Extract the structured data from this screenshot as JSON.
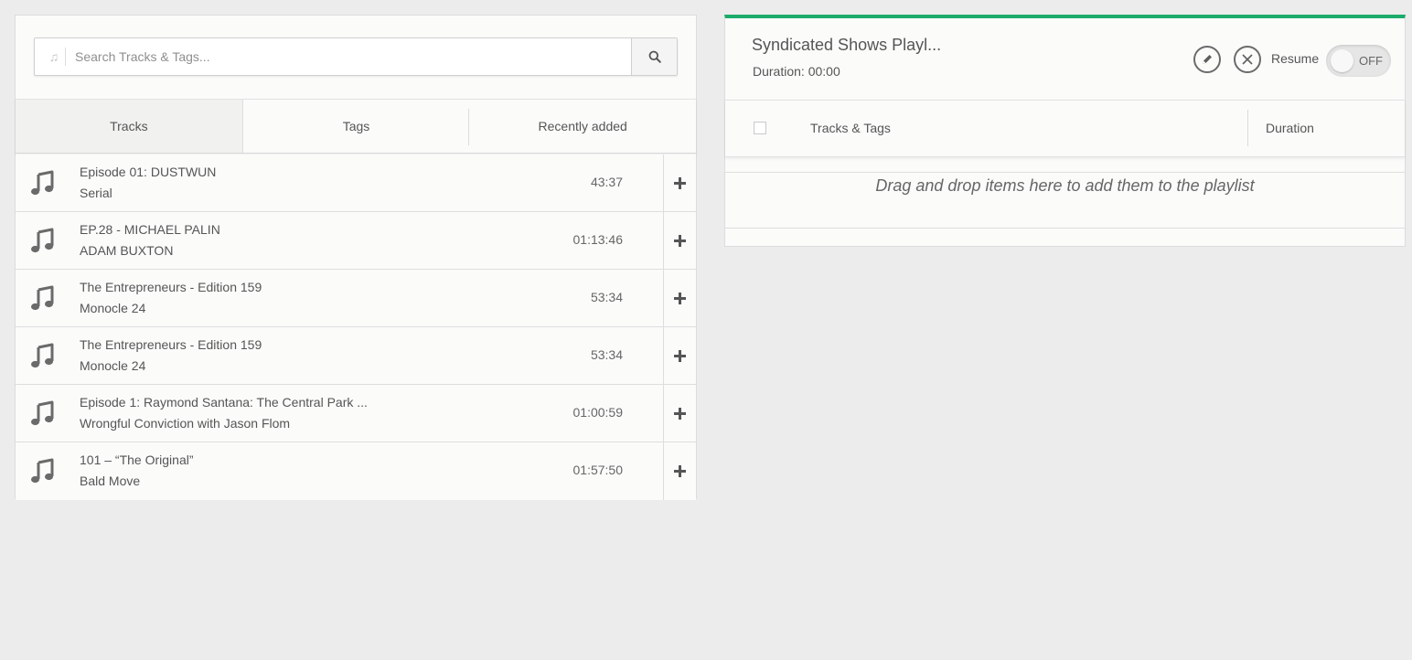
{
  "search": {
    "placeholder": "Search Tracks & Tags..."
  },
  "tabs": [
    {
      "label": "Tracks",
      "active": true
    },
    {
      "label": "Tags",
      "active": false
    },
    {
      "label": "Recently added",
      "active": false
    }
  ],
  "tracks": [
    {
      "title": "Episode 01: DUSTWUN",
      "subtitle": "Serial",
      "duration": "43:37"
    },
    {
      "title": "EP.28 - MICHAEL PALIN",
      "subtitle": "ADAM BUXTON",
      "duration": "01:13:46"
    },
    {
      "title": "The Entrepreneurs - Edition 159",
      "subtitle": "Monocle 24",
      "duration": "53:34"
    },
    {
      "title": "The Entrepreneurs - Edition 159",
      "subtitle": "Monocle 24",
      "duration": "53:34"
    },
    {
      "title": "Episode 1: Raymond Santana: The Central Park ...",
      "subtitle": "Wrongful Conviction with Jason Flom",
      "duration": "01:00:59"
    },
    {
      "title": "101 – “The Original”",
      "subtitle": "Bald Move",
      "duration": "01:57:50"
    }
  ],
  "playlist": {
    "title": "Syndicated Shows Playl...",
    "duration_text": "Duration: 00:00",
    "resume_label": "Resume",
    "toggle_state": "OFF",
    "columns": {
      "tracks": "Tracks & Tags",
      "duration": "Duration"
    },
    "dropzone_text": "Drag and drop items here to add them to the playlist"
  },
  "icons": {
    "search": "search-icon",
    "note": "music-note-icon",
    "add": "plus-icon",
    "edit": "pencil-icon",
    "close": "close-icon"
  },
  "colors": {
    "accent": "#1bab6b",
    "background": "#ececec",
    "panel": "#fbfbfa"
  }
}
